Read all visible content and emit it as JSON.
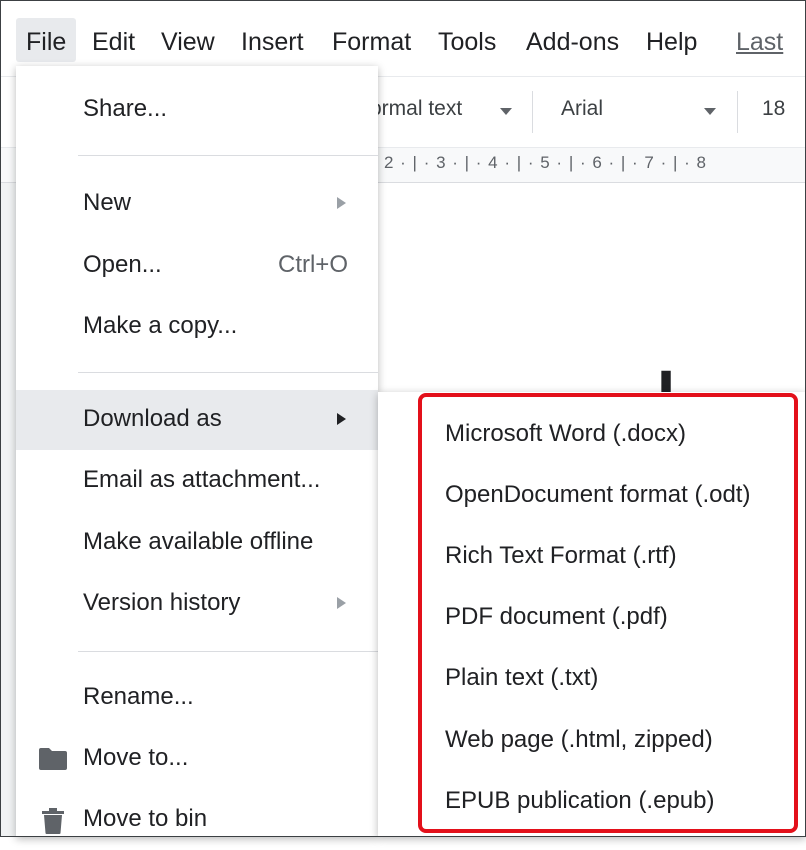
{
  "menubar": {
    "items": [
      "File",
      "Edit",
      "View",
      "Insert",
      "Format",
      "Tools",
      "Add-ons",
      "Help"
    ],
    "last_edit": "Last e"
  },
  "toolbar": {
    "style": "ormal text",
    "font": "Arial",
    "size": "18"
  },
  "ruler": "2 · | · 3 · | · 4 · | · 5 · | · 6 · | · 7 · | · 8",
  "file_menu": {
    "share": "Share...",
    "new": "New",
    "open": "Open...",
    "open_shortcut": "Ctrl+O",
    "make_copy": "Make a copy...",
    "download_as": "Download as",
    "email_attachment": "Email as attachment...",
    "make_offline": "Make available offline",
    "version_history": "Version history",
    "rename": "Rename...",
    "move_to": "Move to...",
    "move_to_bin": "Move to bin"
  },
  "download_submenu": [
    "Microsoft Word (.docx)",
    "OpenDocument format (.odt)",
    "Rich Text Format (.rtf)",
    "PDF document (.pdf)",
    "Plain text (.txt)",
    "Web page (.html, zipped)",
    "EPUB publication (.epub)"
  ],
  "colors": {
    "highlight_border": "#e3101a",
    "active_item_bg": "#e8eaed"
  }
}
